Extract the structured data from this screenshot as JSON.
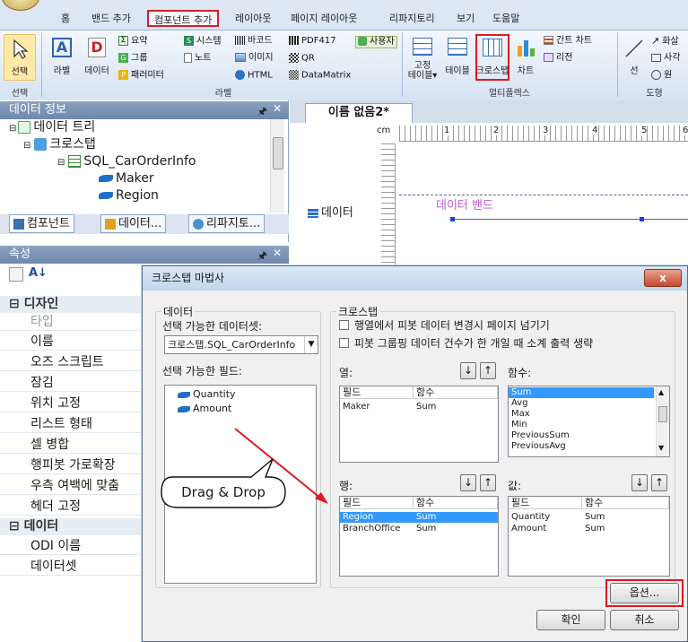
{
  "ribbon": {
    "tabs": [
      "홈",
      "밴드 추가",
      "컴포넌트 추가",
      "레이아웃",
      "페이지 레이아웃",
      "리파지토리",
      "보기",
      "도움말"
    ],
    "active_tab_index": 2,
    "select_label": "선택",
    "label_btn": "라벨",
    "data_btn": "데이터",
    "summary": "요약",
    "group_btn": "그룹",
    "param": "패러미터",
    "system": "시스템",
    "note": "노트",
    "barcode": "바코드",
    "pdf417": "PDF417",
    "image": "이미지",
    "qr": "QR",
    "html": "HTML",
    "datamatrix": "DataMatrix",
    "user": "사용자",
    "fixed_table": "고정\n테이블",
    "table": "테이블",
    "crosstab": "크로스탭",
    "chart": "차트",
    "gantt": "간트 차트",
    "region": "리전",
    "line": "선",
    "arrow": "화살",
    "rect": "사각",
    "circle": "원",
    "group_labels": {
      "select": "선택",
      "label": "라벨",
      "multiplex": "멀티플렉스",
      "shape": "도형"
    }
  },
  "data_panel": {
    "title": "데이터 정보",
    "tree": [
      "데이터 트리",
      "크로스탭",
      "SQL_CarOrderInfo",
      "Maker",
      "Region"
    ],
    "tabs": [
      "컴포넌트",
      "데이터...",
      "리파지토..."
    ]
  },
  "props_panel": {
    "title": "속성",
    "categories": [
      "디자인",
      "데이터"
    ],
    "design_rows": [
      "타입",
      "이름",
      "오즈 스크립트",
      "잠김",
      "위치 고정",
      "리스트 형태",
      "셀 병합",
      "행피봇 가로확장",
      "우측 여백에 맞춤",
      "헤더 고정"
    ],
    "data_rows": [
      "ODI 이름",
      "데이터셋"
    ]
  },
  "doc": {
    "tab": "이름 없음2*",
    "ruler_unit": "cm",
    "ruler_nums": [
      "1",
      "2",
      "3",
      "4",
      "5",
      "6"
    ],
    "band_side_label": "데이터",
    "band_label": "데이터 밴드"
  },
  "dialog": {
    "title": "크로스탭 마법사",
    "close": "x",
    "data_group": "데이터",
    "dataset_label": "선택 가능한 데이터셋:",
    "dataset_value": "크로스탭.SQL_CarOrderInfo",
    "fields_label": "선택 가능한 필드:",
    "fields": [
      "Quantity",
      "Amount"
    ],
    "crosstab_group": "크로스탭",
    "opt1": "행열에서 피봇 데이터 변경시 페이지 넘기기",
    "opt2": "피봇 그룹핑 데이터 건수가 한 개일 때 소계 출력 생략",
    "col_label": "열:",
    "func_label": "함수:",
    "row_label": "행:",
    "value_label": "값:",
    "grid_headers": [
      "필드",
      "함수"
    ],
    "columns": [
      {
        "field": "Maker",
        "func": "Sum"
      }
    ],
    "rows": [
      {
        "field": "Region",
        "func": "Sum"
      },
      {
        "field": "BranchOffice",
        "func": "Sum"
      }
    ],
    "values": [
      {
        "field": "Quantity",
        "func": "Sum"
      },
      {
        "field": "Amount",
        "func": "Sum"
      }
    ],
    "functions": [
      "Sum",
      "Avg",
      "Max",
      "Min",
      "PreviousSum",
      "PreviousAvg"
    ],
    "options_btn": "옵션...",
    "ok_btn": "확인",
    "cancel_btn": "취소",
    "up": "↑",
    "down": "↓"
  },
  "callout": {
    "text": "Drag & Drop"
  },
  "colors": {
    "highlight": "#e0181f",
    "selection": "#3399ff",
    "band": "#c257d9"
  }
}
